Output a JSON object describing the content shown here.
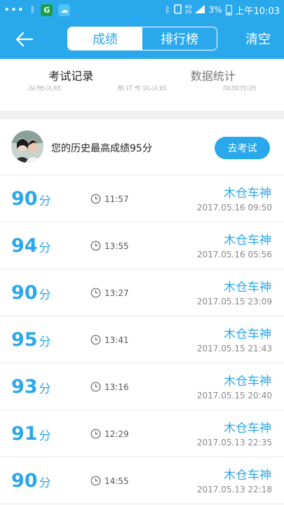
{
  "status_bar": {
    "dots": "•••",
    "bt_label": "ᛒ",
    "app_g": "G",
    "app_cloud": "☁",
    "bt_right": "ᛒ",
    "net_top": "4G",
    "net_bottom": "2G",
    "battery_percent": "3%",
    "time": "上午10:03"
  },
  "header": {
    "tab_scores": "成绩",
    "tab_rank": "排行榜",
    "clear": "清空"
  },
  "tabs": [
    {
      "label": "考试记录",
      "active": true
    },
    {
      "label": "数据统计",
      "active": false
    }
  ],
  "peek": [
    "及格次数",
    "累计考试次数",
    "成绩预测"
  ],
  "best": {
    "text": "您的历史最高成绩95分",
    "button": "去考试"
  },
  "records": [
    {
      "score": "90",
      "unit": "分",
      "duration": "11:57",
      "name": "木仓车神",
      "date": "2017.05.16  09:50"
    },
    {
      "score": "94",
      "unit": "分",
      "duration": "13:55",
      "name": "木仓车神",
      "date": "2017.05.16  05:56"
    },
    {
      "score": "90",
      "unit": "分",
      "duration": "13:27",
      "name": "木仓车神",
      "date": "2017.05.15  23:09"
    },
    {
      "score": "95",
      "unit": "分",
      "duration": "13:41",
      "name": "木仓车神",
      "date": "2017.05.15  21:43"
    },
    {
      "score": "93",
      "unit": "分",
      "duration": "13:16",
      "name": "木仓车神",
      "date": "2017.05.15  20:40"
    },
    {
      "score": "91",
      "unit": "分",
      "duration": "12:29",
      "name": "木仓车神",
      "date": "2017.05.13  22:35"
    },
    {
      "score": "90",
      "unit": "分",
      "duration": "14:55",
      "name": "木仓车神",
      "date": "2017.05.13  22:18"
    }
  ],
  "colors": {
    "accent": "#2aa8ec"
  }
}
